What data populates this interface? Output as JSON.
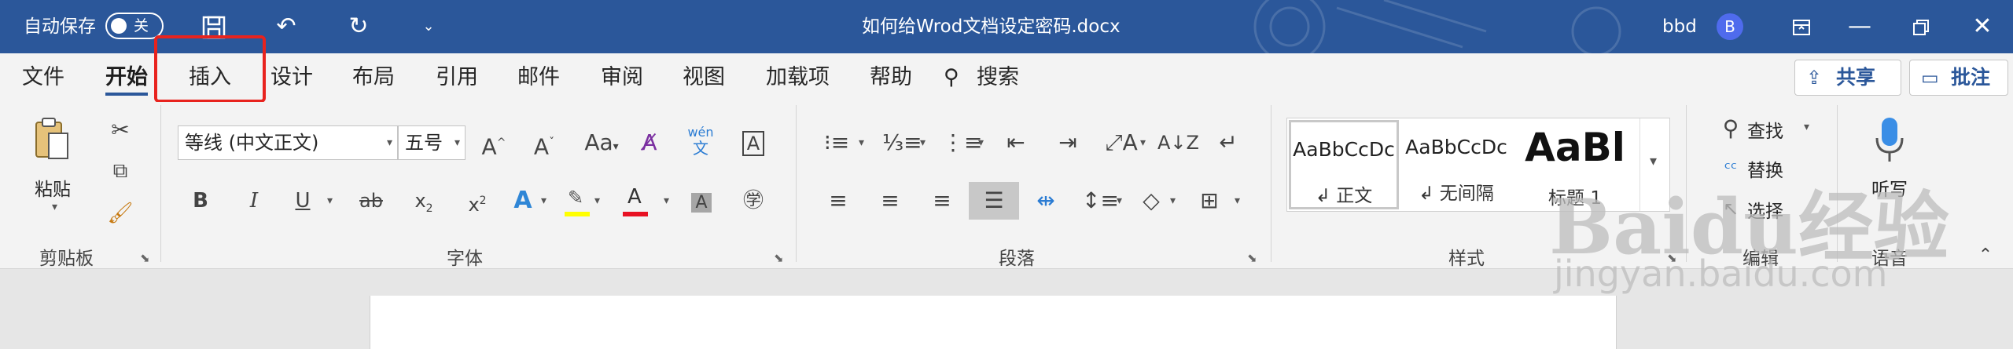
{
  "titlebar": {
    "autosave_label": "自动保存",
    "autosave_state": "关",
    "doc_title": "如何给Wrod文档设定密码.docx",
    "user_name": "bbd",
    "avatar_initial": "B",
    "bg_color": "#2b579a"
  },
  "tabs": [
    "文件",
    "开始",
    "插入",
    "设计",
    "布局",
    "引用",
    "邮件",
    "审阅",
    "视图",
    "加载项",
    "帮助"
  ],
  "active_tab": "开始",
  "highlighted_tab": "插入",
  "search_label": "搜索",
  "share_label": "共享",
  "comment_label": "批注",
  "clipboard": {
    "paste_label": "粘贴",
    "group_label": "剪贴板"
  },
  "font": {
    "font_name": "等线 (中文正文)",
    "font_size": "五号",
    "phonetic_top": "wén",
    "phonetic_bottom": "文",
    "group_label": "字体"
  },
  "paragraph": {
    "group_label": "段落"
  },
  "styles": {
    "items": [
      {
        "sample": "AaBbCcDc",
        "name": "正文"
      },
      {
        "sample": "AaBbCcDc",
        "name": "无间隔"
      },
      {
        "sample": "AaBl",
        "name": "标题 1"
      }
    ],
    "group_label": "样式"
  },
  "editing": {
    "find": "查找",
    "replace": "替换",
    "select": "选择",
    "group_label": "编辑"
  },
  "voice": {
    "dictate": "听写",
    "group_label": "语音"
  },
  "watermark": {
    "brand": "Baidu经验",
    "url": "jingyan.baidu.com"
  }
}
